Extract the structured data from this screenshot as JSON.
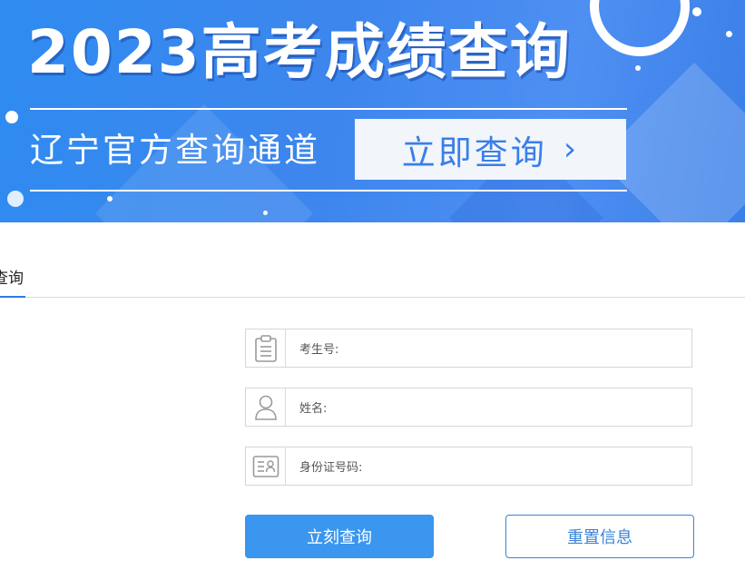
{
  "banner": {
    "title": "2023高考成绩查询",
    "subtitle": "辽宁官方查询通道",
    "cta_label": "立即查询",
    "cta_arrow": "›"
  },
  "tabs": [
    {
      "label": "查询",
      "active": true
    }
  ],
  "form": {
    "fields": [
      {
        "label": "考生号:",
        "icon": "clipboard-icon",
        "value": ""
      },
      {
        "label": "姓名:",
        "icon": "user-icon",
        "value": ""
      },
      {
        "label": "身份证号码:",
        "icon": "id-card-icon",
        "value": ""
      }
    ],
    "submit_label": "立刻查询",
    "reset_label": "重置信息"
  },
  "colors": {
    "banner_bg": "#3d86ee",
    "primary": "#3a96ee",
    "secondary_border": "#3a84d6",
    "tab_underline": "#2c7be5"
  }
}
